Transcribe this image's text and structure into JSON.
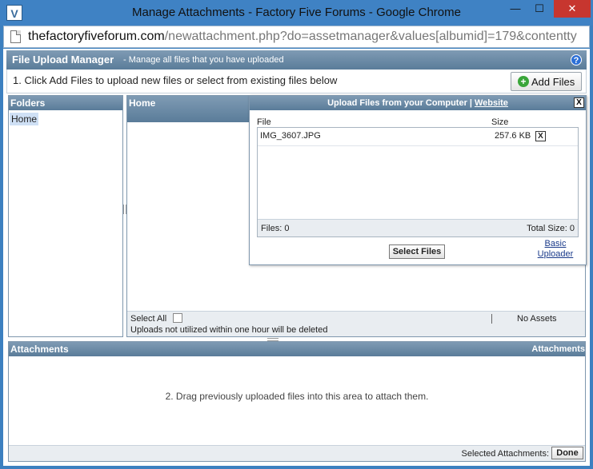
{
  "window": {
    "title": "Manage Attachments - Factory Five Forums - Google Chrome",
    "min_icon": "minimize-icon",
    "max_icon": "maximize-icon",
    "close_icon": "close-icon",
    "min_glyph": "—",
    "max_glyph": "☐",
    "close_glyph": "✕"
  },
  "address": {
    "host": "thefactoryfiveforum.com",
    "path": "/newattachment.php?do=assetmanager&values[albumid]=179&contentty"
  },
  "manager": {
    "title": "File Upload Manager",
    "subtitle": "- Manage all files that you have uploaded",
    "instruction": "1. Click Add Files to upload new files or select from existing files below",
    "add_files_label": "Add Files"
  },
  "folders": {
    "header": "Folders",
    "items": [
      "Home"
    ]
  },
  "files": {
    "header": "Home",
    "select_all": "Select All",
    "note": "Uploads not utilized within one hour will be deleted",
    "no_assets": "No Assets"
  },
  "upload_dialog": {
    "title": "Upload Files from your Computer",
    "separator": "|",
    "website_link": "Website",
    "col_file": "File",
    "col_size": "Size",
    "rows": [
      {
        "name": "IMG_3607.JPG",
        "size": "257.6 KB"
      }
    ],
    "files_count": "Files: 0",
    "total_size": "Total Size: 0",
    "select_files_label": "Select Files",
    "basic_uploader": "Basic Uploader"
  },
  "attachments": {
    "header": "Attachments",
    "header_right": "Attachments",
    "drag_text": "2. Drag previously uploaded files into this area to attach them.",
    "selected_label": "Selected Attachments:",
    "done_label": "Done"
  },
  "colors": {
    "titlebar": "#3f82c4",
    "panel_header": "#6b8aa5",
    "close_red": "#c7362f",
    "add_green": "#3aa63a"
  }
}
